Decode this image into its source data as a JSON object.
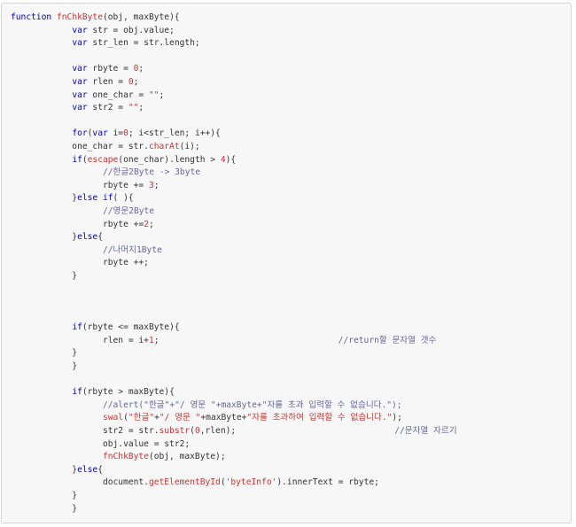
{
  "code": {
    "language": "javascript",
    "lines": [
      [
        {
          "t": "kw",
          "v": "function"
        },
        {
          "t": "pl",
          "v": " "
        },
        {
          "t": "fn",
          "v": "fnChkByte"
        },
        {
          "t": "pl",
          "v": "(obj, maxByte){"
        }
      ],
      [
        {
          "t": "pl",
          "v": "            "
        },
        {
          "t": "kw",
          "v": "var"
        },
        {
          "t": "pl",
          "v": " str = obj.value;"
        }
      ],
      [
        {
          "t": "pl",
          "v": "            "
        },
        {
          "t": "kw",
          "v": "var"
        },
        {
          "t": "pl",
          "v": " str_len = str.length;"
        }
      ],
      [],
      [
        {
          "t": "pl",
          "v": "            "
        },
        {
          "t": "kw",
          "v": "var"
        },
        {
          "t": "pl",
          "v": " rbyte = "
        },
        {
          "t": "num",
          "v": "0"
        },
        {
          "t": "pl",
          "v": ";"
        }
      ],
      [
        {
          "t": "pl",
          "v": "            "
        },
        {
          "t": "kw",
          "v": "var"
        },
        {
          "t": "pl",
          "v": " rlen = "
        },
        {
          "t": "num",
          "v": "0"
        },
        {
          "t": "pl",
          "v": ";"
        }
      ],
      [
        {
          "t": "pl",
          "v": "            "
        },
        {
          "t": "kw",
          "v": "var"
        },
        {
          "t": "pl",
          "v": " one_char = "
        },
        {
          "t": "str",
          "v": "\"\""
        },
        {
          "t": "pl",
          "v": ";"
        }
      ],
      [
        {
          "t": "pl",
          "v": "            "
        },
        {
          "t": "kw",
          "v": "var"
        },
        {
          "t": "pl",
          "v": " str2 = "
        },
        {
          "t": "str",
          "v": "\"\""
        },
        {
          "t": "pl",
          "v": ";"
        }
      ],
      [],
      [
        {
          "t": "pl",
          "v": "            "
        },
        {
          "t": "kw",
          "v": "for"
        },
        {
          "t": "pl",
          "v": "("
        },
        {
          "t": "kw",
          "v": "var"
        },
        {
          "t": "pl",
          "v": " i="
        },
        {
          "t": "num",
          "v": "0"
        },
        {
          "t": "pl",
          "v": "; i<str_len; i++){"
        }
      ],
      [
        {
          "t": "pl",
          "v": "            one_char = str."
        },
        {
          "t": "fn",
          "v": "charAt"
        },
        {
          "t": "pl",
          "v": "(i);"
        }
      ],
      [
        {
          "t": "pl",
          "v": "            "
        },
        {
          "t": "kw",
          "v": "if"
        },
        {
          "t": "pl",
          "v": "("
        },
        {
          "t": "fn",
          "v": "escape"
        },
        {
          "t": "pl",
          "v": "(one_char).length > "
        },
        {
          "t": "num",
          "v": "4"
        },
        {
          "t": "pl",
          "v": "){"
        }
      ],
      [
        {
          "t": "pl",
          "v": "                  "
        },
        {
          "t": "cm",
          "v": "//한글2Byte -> 3byte"
        }
      ],
      [
        {
          "t": "pl",
          "v": "                  rbyte += "
        },
        {
          "t": "num",
          "v": "3"
        },
        {
          "t": "pl",
          "v": ";"
        }
      ],
      [
        {
          "t": "pl",
          "v": "            }"
        },
        {
          "t": "kw",
          "v": "else if"
        },
        {
          "t": "pl",
          "v": "( ){"
        }
      ],
      [
        {
          "t": "pl",
          "v": "                  "
        },
        {
          "t": "cm",
          "v": "//영문2Byte"
        }
      ],
      [
        {
          "t": "pl",
          "v": "                  rbyte +="
        },
        {
          "t": "num",
          "v": "2"
        },
        {
          "t": "pl",
          "v": ";"
        }
      ],
      [
        {
          "t": "pl",
          "v": "            }"
        },
        {
          "t": "kw",
          "v": "else"
        },
        {
          "t": "pl",
          "v": "{"
        }
      ],
      [
        {
          "t": "pl",
          "v": "                  "
        },
        {
          "t": "cm",
          "v": "//나머지1Byte"
        }
      ],
      [
        {
          "t": "pl",
          "v": "                  rbyte ++;"
        }
      ],
      [
        {
          "t": "pl",
          "v": "            }"
        }
      ],
      [],
      [],
      [],
      [
        {
          "t": "pl",
          "v": "            "
        },
        {
          "t": "kw",
          "v": "if"
        },
        {
          "t": "pl",
          "v": "(rbyte <= maxByte){"
        }
      ],
      [
        {
          "t": "pl",
          "v": "                  rlen = i+"
        },
        {
          "t": "num",
          "v": "1"
        },
        {
          "t": "pl",
          "v": ";                                   "
        },
        {
          "t": "cm",
          "v": "//return할 문자열 갯수"
        }
      ],
      [
        {
          "t": "pl",
          "v": "            }"
        }
      ],
      [
        {
          "t": "pl",
          "v": "            }"
        }
      ],
      [],
      [
        {
          "t": "pl",
          "v": "            "
        },
        {
          "t": "kw",
          "v": "if"
        },
        {
          "t": "pl",
          "v": "(rbyte > maxByte){"
        }
      ],
      [
        {
          "t": "pl",
          "v": "                  "
        },
        {
          "t": "cm",
          "v": "//alert(\"한글\"+\"/ 영문 \"+maxByte+\"자를 초과 입력할 수 없습니다.\");"
        }
      ],
      [
        {
          "t": "pl",
          "v": "                  "
        },
        {
          "t": "fn",
          "v": "swal"
        },
        {
          "t": "pl",
          "v": "("
        },
        {
          "t": "str",
          "v": "\"한글\""
        },
        {
          "t": "pl",
          "v": "+"
        },
        {
          "t": "str",
          "v": "\"/ 영문 \""
        },
        {
          "t": "pl",
          "v": "+maxByte+"
        },
        {
          "t": "str",
          "v": "\"자를 초과하여 입력할 수 없습니다.\""
        },
        {
          "t": "pl",
          "v": ");"
        }
      ],
      [
        {
          "t": "pl",
          "v": "                  str2 = str."
        },
        {
          "t": "fn",
          "v": "substr"
        },
        {
          "t": "pl",
          "v": "("
        },
        {
          "t": "num",
          "v": "0"
        },
        {
          "t": "pl",
          "v": ",rlen);                               "
        },
        {
          "t": "cm",
          "v": "//문자열 자르기"
        }
      ],
      [
        {
          "t": "pl",
          "v": "                  obj.value = str2;"
        }
      ],
      [
        {
          "t": "pl",
          "v": "                  "
        },
        {
          "t": "fn",
          "v": "fnChkByte"
        },
        {
          "t": "pl",
          "v": "(obj, maxByte);"
        }
      ],
      [
        {
          "t": "pl",
          "v": "            }"
        },
        {
          "t": "kw",
          "v": "else"
        },
        {
          "t": "pl",
          "v": "{"
        }
      ],
      [
        {
          "t": "pl",
          "v": "                  document."
        },
        {
          "t": "fn",
          "v": "getElementById"
        },
        {
          "t": "pl",
          "v": "("
        },
        {
          "t": "str",
          "v": "'byteInfo'"
        },
        {
          "t": "pl",
          "v": ").innerText = rbyte;"
        }
      ],
      [
        {
          "t": "pl",
          "v": "            }"
        }
      ],
      [
        {
          "t": "pl",
          "v": "            }"
        }
      ]
    ]
  }
}
